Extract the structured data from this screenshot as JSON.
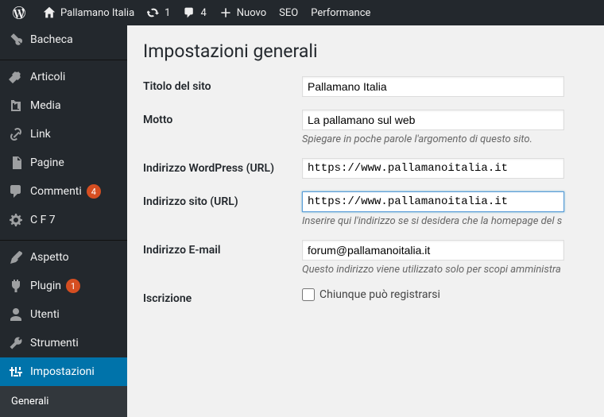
{
  "adminbar": {
    "site_title": "Pallamano Italia",
    "updates_count": "1",
    "comments_count": "4",
    "new_label": "Nuovo",
    "seo_label": "SEO",
    "perf_label": "Performance"
  },
  "sidebar": {
    "dashboard": "Bacheca",
    "posts": "Articoli",
    "media": "Media",
    "links": "Link",
    "pages": "Pagine",
    "comments": "Commenti",
    "comments_badge": "4",
    "cf7": "C F 7",
    "appearance": "Aspetto",
    "plugins": "Plugin",
    "plugins_badge": "1",
    "users": "Utenti",
    "tools": "Strumenti",
    "settings": "Impostazioni",
    "submenu_general": "Generali"
  },
  "page": {
    "title": "Impostazioni generali",
    "site_title_label": "Titolo del sito",
    "site_title_value": "Pallamano Italia",
    "tagline_label": "Motto",
    "tagline_value": "La pallamano sul web",
    "tagline_desc": "Spiegare in poche parole l'argomento di questo sito.",
    "wp_url_label": "Indirizzo WordPress (URL)",
    "wp_url_value": "https://www.pallamanoitalia.it",
    "site_url_label": "Indirizzo sito (URL)",
    "site_url_value": "https://www.pallamanoitalia.it",
    "site_url_desc": "Inserire qui l'indirizzo se si desidera che la homepage del s",
    "email_label": "Indirizzo E-mail",
    "email_value": "forum@pallamanoitalia.it",
    "email_desc": "Questo indirizzo viene utilizzato solo per scopi amministra",
    "membership_label": "Iscrizione",
    "membership_checkbox": "Chiunque può registrarsi"
  }
}
